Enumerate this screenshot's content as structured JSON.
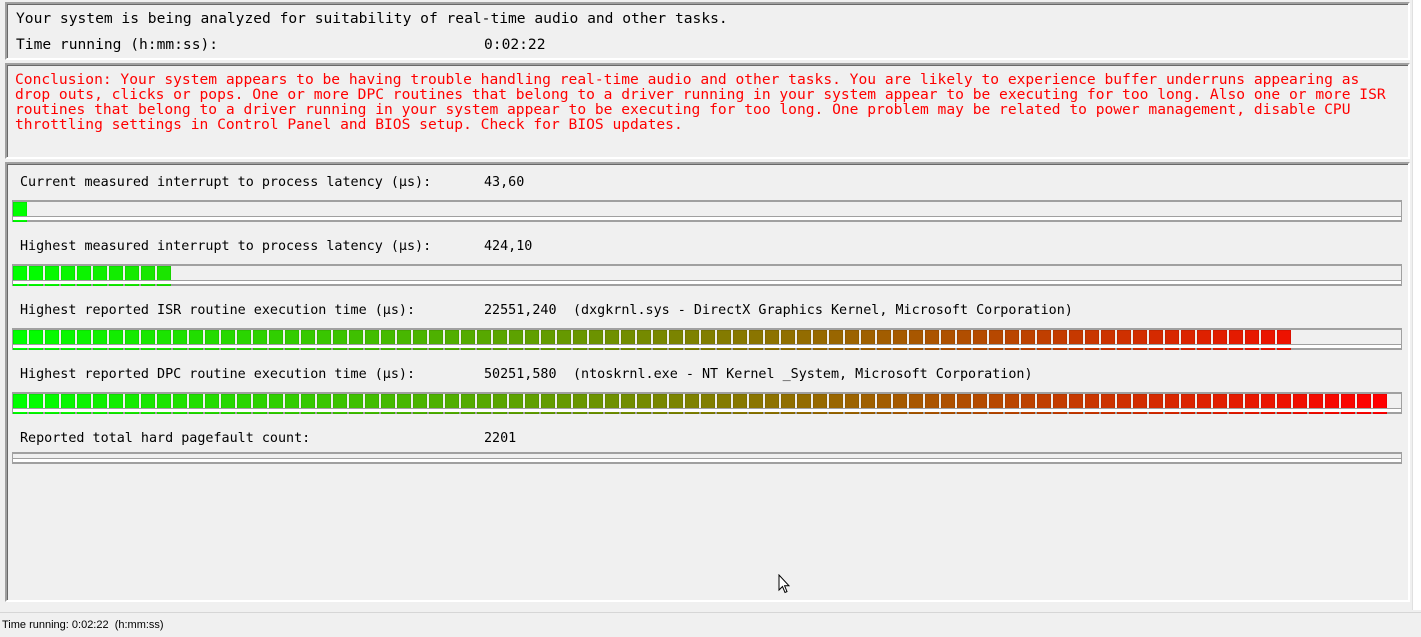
{
  "header": {
    "line1": "Your system is being analyzed for suitability of real-time audio and other tasks.",
    "time_label": "Time running (h:mm:ss):",
    "time_value": "0:02:22"
  },
  "conclusion": {
    "text": "Conclusion: Your system appears to be having trouble handling real-time audio and other tasks. You are likely to experience buffer underruns appearing as drop outs, clicks or pops. One or more DPC routines that belong to a driver running in your system appear to be executing for too long. Also one or more ISR routines that belong to a driver running in your system appear to be executing for too long. One problem may be related to power management, disable CPU throttling settings in Control Panel and BIOS setup. Check for BIOS updates.",
    "color": "#ff0000"
  },
  "metrics": [
    {
      "label": "Current measured interrupt to process latency (µs):",
      "value": "43,60",
      "detail": "",
      "fill_fraction": 0.011
    },
    {
      "label": "Highest measured interrupt to process latency (µs):",
      "value": "424,10",
      "detail": "",
      "fill_fraction": 0.115
    },
    {
      "label": "Highest reported ISR routine execution time (µs):",
      "value": "22551,240",
      "detail": "(dxgkrnl.sys - DirectX Graphics Kernel, Microsoft Corporation)",
      "fill_fraction": 0.932
    },
    {
      "label": "Highest reported DPC routine execution time (µs):",
      "value": "50251,580",
      "detail": "(ntoskrnl.exe - NT Kernel _System, Microsoft Corporation)",
      "fill_fraction": 1.0
    },
    {
      "label": "Reported total hard pagefault count:",
      "value": "2201",
      "detail": "",
      "fill_fraction": 0
    }
  ],
  "colors": {
    "bar_start": "#00ff00",
    "bar_mid": "#7f8000",
    "bar_end": "#ff0000"
  },
  "statusbar": {
    "text": "Time running: 0:02:22  (h:mm:ss)"
  }
}
